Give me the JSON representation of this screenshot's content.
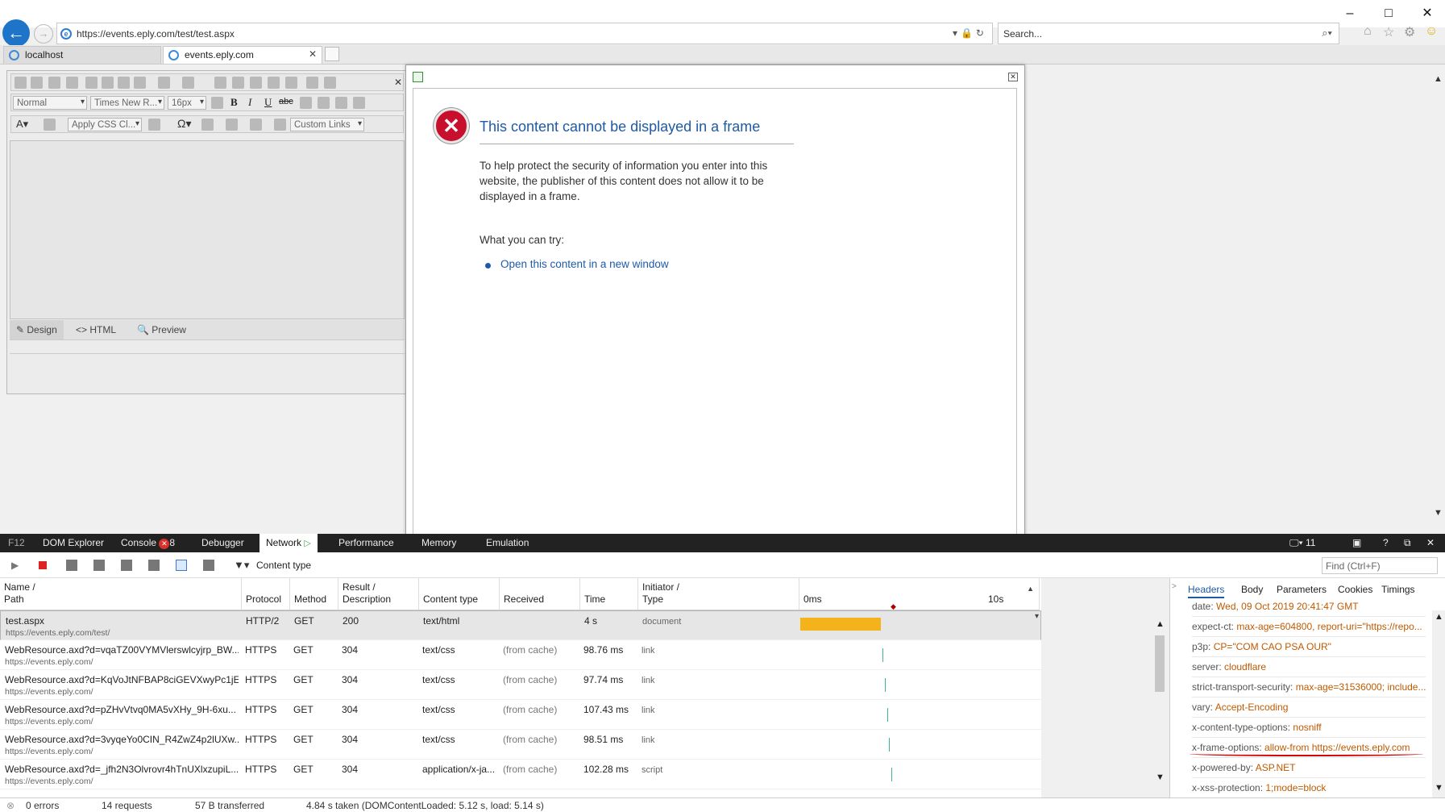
{
  "browser": {
    "url": "https://events.eply.com/test/test.aspx",
    "search_placeholder": "Search...",
    "tabs": [
      {
        "label": "localhost"
      },
      {
        "label": "events.eply.com"
      }
    ]
  },
  "editor": {
    "format_select": "Normal",
    "font_select": "Times New R...",
    "size_select": "16px",
    "css_select": "Apply CSS Cl...",
    "links_select": "Custom Links",
    "modes": [
      "Design",
      "HTML",
      "Preview"
    ]
  },
  "error_dialog": {
    "title": "This content cannot be displayed in a frame",
    "body": "To help protect the security of information you enter into this website, the publisher of this content does not allow it to be displayed in a frame.",
    "try_label": "What you can try:",
    "link": "Open this content in a new window"
  },
  "devtools": {
    "tabs": [
      "F12",
      "DOM Explorer",
      "Console",
      "Debugger",
      "Network",
      "Performance",
      "Memory",
      "Emulation"
    ],
    "console_errors": "8",
    "browser_mode": "11",
    "content_type_label": "Content type",
    "find_placeholder": "Find (Ctrl+F)",
    "columns": [
      "Name /",
      "Path",
      "Protocol",
      "Method",
      "Result /",
      "Description",
      "Content type",
      "Received",
      "Time",
      "Initiator /",
      "Type"
    ],
    "timeline_start": "0ms",
    "timeline_end": "10s",
    "rows": [
      {
        "name": "test.aspx",
        "path": "https://events.eply.com/test/",
        "protocol": "HTTP/2",
        "method": "GET",
        "result": "200",
        "ctype": "text/html",
        "received": "",
        "time": "4 s",
        "initiator": "document"
      },
      {
        "name": "WebResource.axd?d=vqaTZ00VYMVlerswlcyjrp_BW...",
        "path": "https://events.eply.com/",
        "protocol": "HTTPS",
        "method": "GET",
        "result": "304",
        "ctype": "text/css",
        "received": "(from cache)",
        "time": "98.76 ms",
        "initiator": "link"
      },
      {
        "name": "WebResource.axd?d=KqVoJtNFBAP8ciGEVXwyPc1jE...",
        "path": "https://events.eply.com/",
        "protocol": "HTTPS",
        "method": "GET",
        "result": "304",
        "ctype": "text/css",
        "received": "(from cache)",
        "time": "97.74 ms",
        "initiator": "link"
      },
      {
        "name": "WebResource.axd?d=pZHvVtvq0MA5vXHy_9H-6xu...",
        "path": "https://events.eply.com/",
        "protocol": "HTTPS",
        "method": "GET",
        "result": "304",
        "ctype": "text/css",
        "received": "(from cache)",
        "time": "107.43 ms",
        "initiator": "link"
      },
      {
        "name": "WebResource.axd?d=3vyqeYo0CIN_R4ZwZ4p2lUXw...",
        "path": "https://events.eply.com/",
        "protocol": "HTTPS",
        "method": "GET",
        "result": "304",
        "ctype": "text/css",
        "received": "(from cache)",
        "time": "98.51 ms",
        "initiator": "link"
      },
      {
        "name": "WebResource.axd?d=_jfh2N3Olvrovr4hTnUXlxzupiL...",
        "path": "https://events.eply.com/",
        "protocol": "HTTPS",
        "method": "GET",
        "result": "304",
        "ctype": "application/x-ja...",
        "received": "(from cache)",
        "time": "102.28 ms",
        "initiator": "script"
      }
    ],
    "detail_tabs": [
      "Headers",
      "Body",
      "Parameters",
      "Cookies",
      "Timings"
    ],
    "headers": [
      {
        "key": "date:",
        "value": "Wed, 09 Oct 2019 20:41:47 GMT"
      },
      {
        "key": "expect-ct:",
        "value": "max-age=604800, report-uri=\"https://repo..."
      },
      {
        "key": "p3p:",
        "value": "CP=\"COM CAO PSA OUR\""
      },
      {
        "key": "server:",
        "value": "cloudflare"
      },
      {
        "key": "strict-transport-security:",
        "value": "max-age=31536000; include..."
      },
      {
        "key": "vary:",
        "value": "Accept-Encoding"
      },
      {
        "key": "x-content-type-options:",
        "value": "nosniff"
      },
      {
        "key": "x-frame-options:",
        "value": "allow-from https://events.eply.com"
      },
      {
        "key": "x-powered-by:",
        "value": "ASP.NET"
      },
      {
        "key": "x-xss-protection:",
        "value": "1;mode=block"
      }
    ],
    "status": {
      "errors": "0 errors",
      "requests": "14 requests",
      "transferred": "57 B transferred",
      "taken": "4.84 s taken (DOMContentLoaded: 5.12 s, load: 5.14 s)"
    }
  },
  "colors": {
    "accent": "#1e5aa8",
    "error": "#c8102e",
    "timeline_bar": "#f4b21b",
    "header_value": "#c05a00"
  }
}
